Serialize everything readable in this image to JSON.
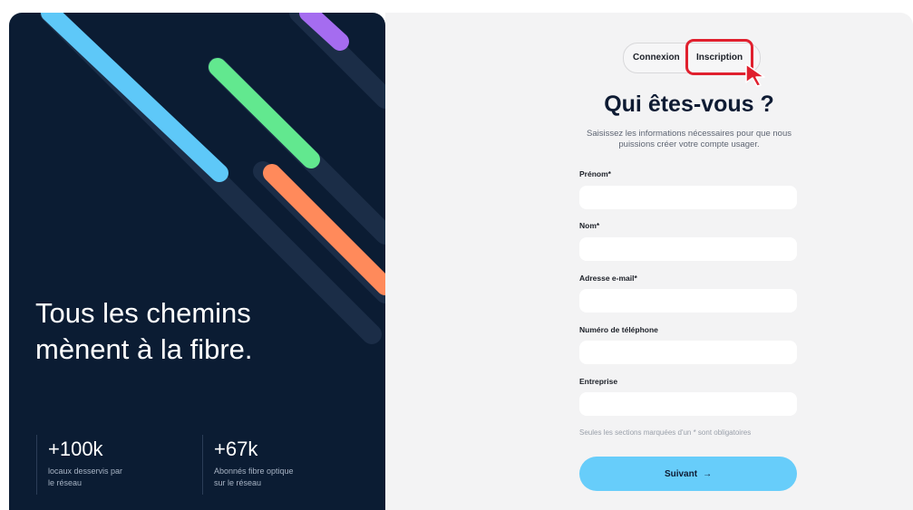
{
  "hero": {
    "headline": "Tous les chemins\nmènent à la fibre.",
    "stats": [
      {
        "value": "+100k",
        "caption": "locaux desservis par\nle réseau"
      },
      {
        "value": "+67k",
        "caption": "Abonnés fibre optique\nsur le réseau"
      }
    ]
  },
  "tabs": {
    "login_label": "Connexion",
    "signup_label": "Inscription"
  },
  "form": {
    "title": "Qui êtes-vous ?",
    "subtitle": "Saisissez les informations nécessaires pour que nous puissions créer votre compte usager.",
    "fields": [
      {
        "label": "Prénom*",
        "value": ""
      },
      {
        "label": "Nom*",
        "value": ""
      },
      {
        "label": "Adresse e-mail*",
        "value": ""
      },
      {
        "label": "Numéro de téléphone",
        "value": ""
      },
      {
        "label": "Entreprise",
        "value": ""
      }
    ],
    "required_note": "Seules les sections marquées d'un * sont obligatoires",
    "submit_label": "Suivant",
    "submit_icon": "arrow-right-icon"
  },
  "colors": {
    "hero_bg": "#0b1c33",
    "streak_blue": "#5ec8f8",
    "streak_green": "#62e88f",
    "streak_orange": "#ff8a5b",
    "streak_purple": "#a56cf0",
    "accent_button": "#67cdfa",
    "highlight_red": "#e0202e"
  }
}
